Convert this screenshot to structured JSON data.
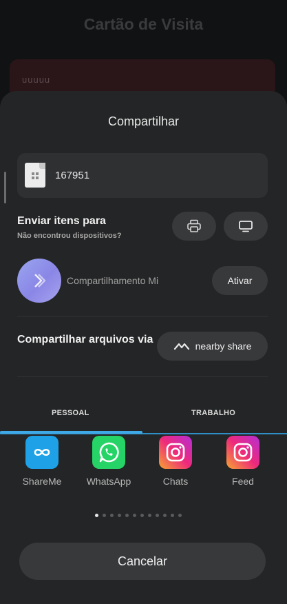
{
  "background": {
    "title": "Cartão de Visita",
    "card_text": "uuuuu"
  },
  "sheet": {
    "title": "Compartilhar",
    "file_name": "167951",
    "send_title": "Enviar itens para",
    "send_subtitle": "Não encontrou dispositivos?",
    "mi_label": "Compartilhamento Mi",
    "ativar_label": "Ativar",
    "share_via_label": "Compartilhar arquivos via",
    "nearby_label": "nearby share",
    "tabs": [
      {
        "label": "PESSOAL",
        "active": true
      },
      {
        "label": "TRABALHO",
        "active": false
      }
    ],
    "apps": [
      {
        "label": "ShareMe",
        "icon": "shareme-icon"
      },
      {
        "label": "WhatsApp",
        "icon": "whatsapp-icon"
      },
      {
        "label": "Chats",
        "icon": "instagram-icon"
      },
      {
        "label": "Feed",
        "icon": "instagram-icon"
      }
    ],
    "page_count": 12,
    "current_page": 1,
    "cancel_label": "Cancelar"
  },
  "colors": {
    "accent": "#3fa8e6",
    "sheet_bg": "#242526",
    "button_bg": "#38393b",
    "shareme": "#1ea1e6",
    "whatsapp": "#25d366"
  }
}
